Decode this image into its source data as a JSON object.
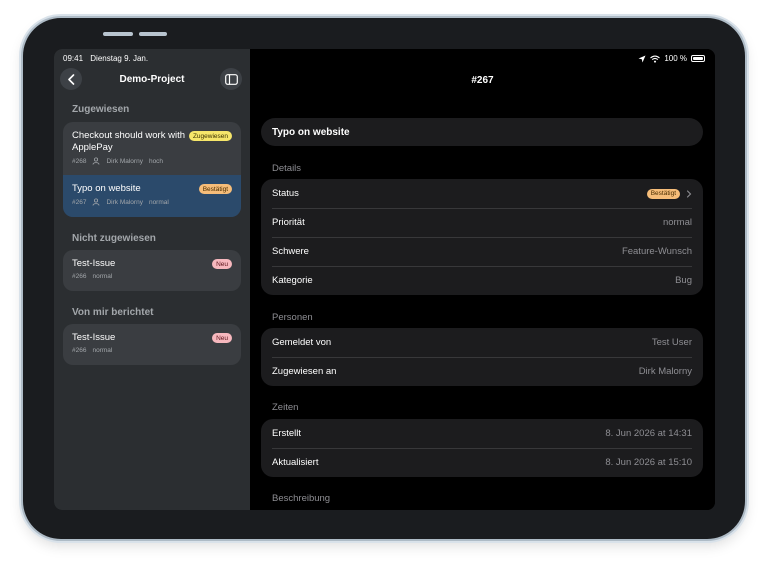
{
  "status_bar": {
    "time": "09:41",
    "date": "Dienstag 9. Jan.",
    "battery": "100 %"
  },
  "sidebar": {
    "title": "Demo-Project",
    "sections": [
      {
        "title": "Zugewiesen",
        "items": [
          {
            "title": "Checkout should work with ApplePay",
            "number": "#268",
            "assignee": "Dirk Malorny",
            "priority": "hoch",
            "badge": "Zugewiesen"
          },
          {
            "title": "Typo on website",
            "number": "#267",
            "assignee": "Dirk Malorny",
            "priority": "normal",
            "badge": "Bestätigt"
          }
        ]
      },
      {
        "title": "Nicht zugewiesen",
        "items": [
          {
            "title": "Test-Issue",
            "number": "#266",
            "priority": "normal",
            "badge": "Neu"
          }
        ]
      },
      {
        "title": "Von mir berichtet",
        "items": [
          {
            "title": "Test-Issue",
            "number": "#266",
            "priority": "normal",
            "badge": "Neu"
          }
        ]
      }
    ]
  },
  "main": {
    "title": "#267",
    "issue_title": "Typo on website",
    "details": {
      "title": "Details",
      "status_label": "Status",
      "status_value": "Bestätigt",
      "priority_label": "Priorität",
      "priority_value": "normal",
      "severity_label": "Schwere",
      "severity_value": "Feature-Wunsch",
      "category_label": "Kategorie",
      "category_value": "Bug"
    },
    "people": {
      "title": "Personen",
      "reporter_label": "Gemeldet von",
      "reporter_value": "Test User",
      "assignee_label": "Zugewiesen an",
      "assignee_value": "Dirk Malorny"
    },
    "times": {
      "title": "Zeiten",
      "created_label": "Erstellt",
      "created_value": "8. Jun 2026 at 14:31",
      "updated_label": "Aktualisiert",
      "updated_value": "8. Jun 2026 at 15:10"
    },
    "description_title": "Beschreibung"
  },
  "icons": [
    "back-chevron-icon",
    "sidebar-toggle-icon",
    "location-icon",
    "wifi-icon",
    "battery-icon",
    "person-icon",
    "chevron-right-icon"
  ]
}
